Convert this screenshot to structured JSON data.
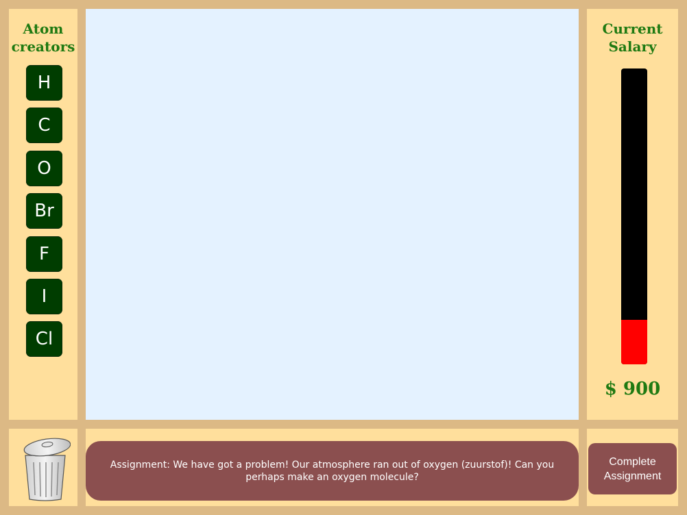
{
  "left_panel": {
    "title_line1": "Atom",
    "title_line2": "creators",
    "atoms": [
      {
        "symbol": "H"
      },
      {
        "symbol": "C"
      },
      {
        "symbol": "O"
      },
      {
        "symbol": "Br"
      },
      {
        "symbol": "F"
      },
      {
        "symbol": "I"
      },
      {
        "symbol": "Cl"
      }
    ]
  },
  "right_panel": {
    "title_line1": "Current",
    "title_line2": "Salary",
    "salary_text": "$ 900",
    "salary_level_percent": 15
  },
  "assignment": {
    "text": "Assignment: We have got a problem! Our atmosphere ran out of oxygen (zuurstof)! Can you perhaps make an oxygen molecule?"
  },
  "complete_button": {
    "line1": "Complete",
    "line2": "Assignment"
  },
  "colors": {
    "frame": "#dcb985",
    "panel": "#ffdf9c",
    "canvas": "#e4f2ff",
    "atom_button": "#003d00",
    "heading": "#1f7a12",
    "message_bg": "#8b4f4f",
    "salary_fill": "#ff0000"
  },
  "icons": {
    "trash": "trash-can-icon"
  }
}
